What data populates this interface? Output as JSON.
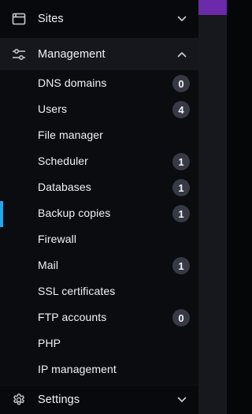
{
  "sidebar": {
    "sections": {
      "sites": {
        "label": "Sites",
        "icon": "browser-window-icon",
        "expanded": false
      },
      "management": {
        "label": "Management",
        "icon": "sliders-icon",
        "expanded": true
      },
      "settings": {
        "label": "Settings",
        "icon": "gear-icon",
        "expanded": false
      }
    },
    "management_items": [
      {
        "label": "DNS domains",
        "badge": "0"
      },
      {
        "label": "Users",
        "badge": "4"
      },
      {
        "label": "File manager",
        "badge": null
      },
      {
        "label": "Scheduler",
        "badge": "1"
      },
      {
        "label": "Databases",
        "badge": "1"
      },
      {
        "label": "Backup copies",
        "badge": "1",
        "active": true
      },
      {
        "label": "Firewall",
        "badge": null
      },
      {
        "label": "Mail",
        "badge": "1"
      },
      {
        "label": "SSL certificates",
        "badge": null
      },
      {
        "label": "FTP accounts",
        "badge": "0"
      },
      {
        "label": "PHP",
        "badge": null
      },
      {
        "label": "IP management",
        "badge": null
      }
    ]
  },
  "colors": {
    "accent_active": "#25a6e8",
    "topbar_accent": "#6a2aa9",
    "badge_bg": "#353a45"
  }
}
